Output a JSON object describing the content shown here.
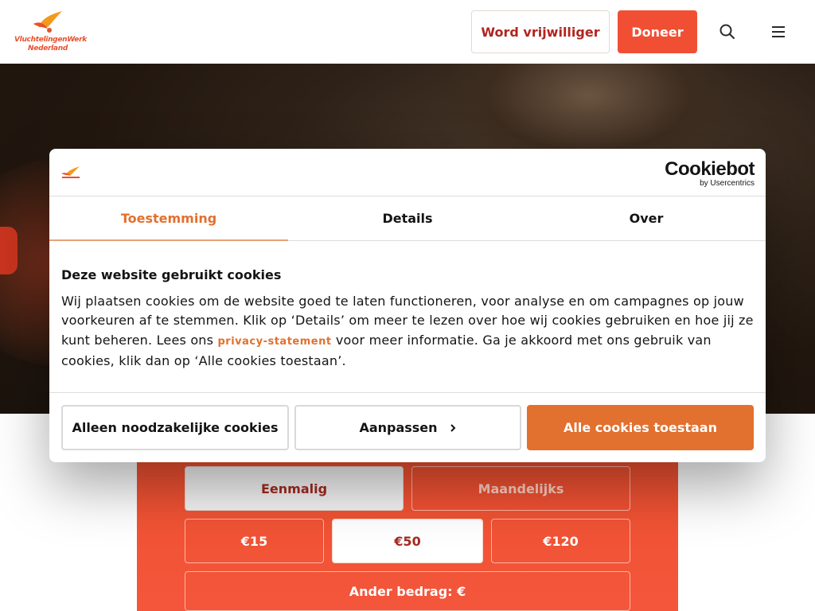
{
  "header": {
    "logo_line1": "VluchtelingenWerk",
    "logo_line2": "Nederland",
    "volunteer_label": "Word vrijwilliger",
    "donate_label": "Doneer",
    "search_icon": "search-icon",
    "menu_icon": "hamburger-menu-icon"
  },
  "cookie_dialog": {
    "provider_logo": "Cookiebot",
    "provider_sub": "by Usercentrics",
    "tabs": [
      {
        "label": "Toestemming",
        "active": true
      },
      {
        "label": "Details",
        "active": false
      },
      {
        "label": "Over",
        "active": false
      }
    ],
    "title": "Deze website gebruikt cookies",
    "text_before_link": "Wij plaatsen cookies om de website goed te laten functioneren, voor analyse en om campagnes op jouw voorkeuren af te stemmen. Klik op ‘Details’ om meer te lezen over hoe wij cookies gebruiken en hoe jij ze kunt beheren. Lees ons ",
    "link_text": "privacy-statement",
    "text_after_link": " voor meer informatie. Ga je akkoord met ons gebruik van cookies, klik dan op ‘Alle cookies toestaan’.",
    "btn_necessary": "Alleen noodzakelijke cookies",
    "btn_customize": "Aanpassen",
    "btn_allow_all": "Alle cookies toestaan"
  },
  "donation": {
    "frequency": [
      "Eenmalig",
      "Maandelijks"
    ],
    "amounts": [
      "€15",
      "€50",
      "€120"
    ],
    "other_amount": "Ander bedrag: €"
  },
  "colors": {
    "brand_red": "#f14f33",
    "cookie_accent": "#e2702e",
    "dark_red_text": "#b2241f"
  }
}
